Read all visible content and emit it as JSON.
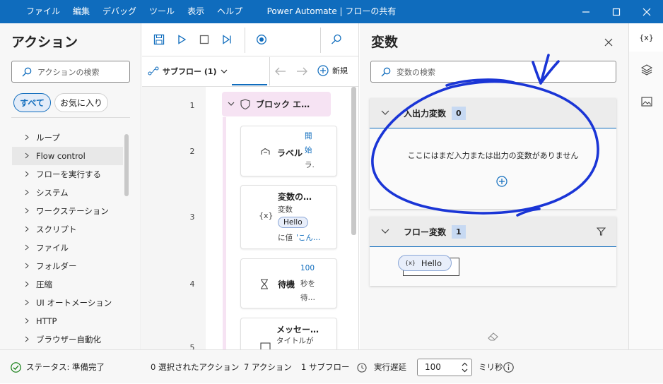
{
  "window": {
    "title": "Power Automate | フローの共有",
    "menu": [
      "ファイル",
      "編集",
      "デバッグ",
      "ツール",
      "表示",
      "ヘルプ"
    ]
  },
  "actions_panel": {
    "title": "アクション",
    "search_placeholder": "アクションの検索",
    "filter_all": "すべて",
    "filter_favorites": "お気に入り",
    "items": [
      {
        "label": "ループ"
      },
      {
        "label": "Flow control"
      },
      {
        "label": "フローを実行する"
      },
      {
        "label": "システム"
      },
      {
        "label": "ワークステーション"
      },
      {
        "label": "スクリプト"
      },
      {
        "label": "ファイル"
      },
      {
        "label": "フォルダー"
      },
      {
        "label": "圧縮"
      },
      {
        "label": "UI オートメーション"
      },
      {
        "label": "HTTP"
      },
      {
        "label": "ブラウザー自動化"
      }
    ]
  },
  "flow_panel": {
    "subflow_label": "サブフロー (1)",
    "new_label": "新規",
    "block": {
      "line": "1",
      "title": "ブロック エ…"
    },
    "steps": [
      {
        "line": "2",
        "icon": "label",
        "title": "ラベル",
        "side_top": "開",
        "side_mid": "始",
        "side_bottom": "ラ."
      },
      {
        "line": "3",
        "icon": "{x}",
        "title": "変数の…",
        "sub": "変数",
        "tag": "Hello",
        "sub2": "に値 ",
        "sub2_q": "'こん…"
      },
      {
        "line": "4",
        "icon": "hourglass",
        "title": "待機",
        "side_top": "100",
        "side_mid": "秒を",
        "side_bottom": "待…"
      },
      {
        "line": "5",
        "icon": "message",
        "title": "メッセー…",
        "sub": "タイトルが"
      }
    ]
  },
  "variables_panel": {
    "title": "変数",
    "search_placeholder": "変数の検索",
    "io_section": {
      "title": "入出力変数",
      "count": "0",
      "empty_text": "ここにはまだ入力または出力の変数がありません"
    },
    "flow_section": {
      "title": "フロー変数",
      "count": "1",
      "variable": "Hello"
    }
  },
  "rail": {
    "variables_icon": "{x}"
  },
  "status_bar": {
    "status": "ステータス: 準備完了",
    "selected": "0 選択されたアクション",
    "actions": "7 アクション",
    "subflows": "1 サブフロー",
    "delay_label": "実行遅延",
    "delay_value": "100",
    "unit": "ミリ秒"
  },
  "colors": {
    "accent": "#0f6cbd",
    "annotation": "#1a35d6",
    "block": "#f6e3f3"
  }
}
